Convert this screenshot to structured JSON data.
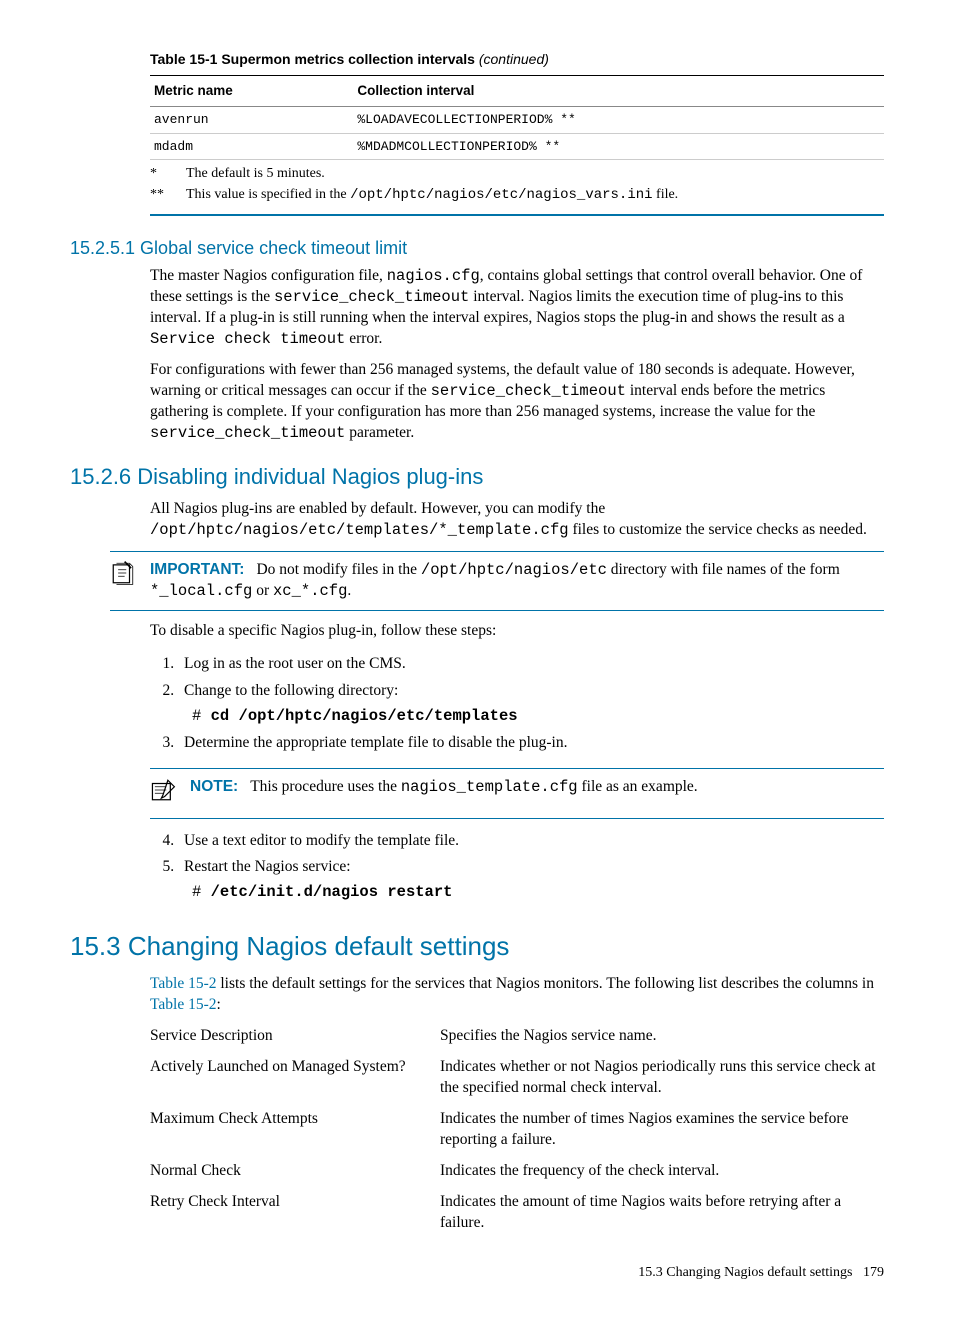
{
  "table": {
    "caption": "Table 15-1 Supermon metrics collection intervals",
    "continued": "(continued)",
    "headers": {
      "c1": "Metric name",
      "c2": "Collection interval"
    },
    "rows": [
      {
        "metric": "avenrun",
        "interval": "%LOADAVECOLLECTIONPERIOD% **"
      },
      {
        "metric": "mdadm",
        "interval": "%MDADMCOLLECTIONPERIOD% **"
      }
    ],
    "footnotes": [
      {
        "mark": "*",
        "text_a": "The default is 5 minutes."
      },
      {
        "mark": "**",
        "text_a": "This value is specified in the ",
        "code": "/opt/hptc/nagios/etc/nagios_vars.ini",
        "text_b": " file."
      }
    ]
  },
  "sec_15251": {
    "heading": "15.2.5.1 Global service check timeout limit",
    "p1_a": "The master Nagios configuration file, ",
    "p1_code1": "nagios.cfg",
    "p1_b": ", contains global settings that control overall behavior. One of these settings is the ",
    "p1_code2": "service_check_timeout",
    "p1_c": " interval. Nagios limits the execution time of plug-ins to this interval. If a plug-in is still running when the interval expires, Nagios stops the plug-in and shows the result as a ",
    "p1_code3": "Service check timeout",
    "p1_d": " error.",
    "p2_a": "For configurations with fewer than 256 managed systems, the default value of 180 seconds is adequate. However, warning or critical messages can occur if the ",
    "p2_code1": "service_check_timeout",
    "p2_b": " interval ends before the metrics gathering is complete. If your configuration has more than 256 managed systems, increase the value for the ",
    "p2_code2": "service_check_timeout",
    "p2_c": " parameter."
  },
  "sec_1526": {
    "heading": "15.2.6 Disabling individual Nagios plug-ins",
    "p1_a": "All Nagios plug-ins are enabled by default. However, you can modify the ",
    "p1_code1": "/opt/hptc/nagios/etc/templates/*_template.cfg",
    "p1_b": " files to customize the service checks as needed.",
    "important_label": "IMPORTANT:",
    "imp_a": "Do not modify files in the ",
    "imp_code1": "/opt/hptc/nagios/etc",
    "imp_b": " directory with file names of the form ",
    "imp_code2": "*_local.cfg",
    "imp_c": " or ",
    "imp_code3": "xc_*.cfg",
    "imp_d": ".",
    "p2": "To disable a specific Nagios plug-in, follow these steps:",
    "steps": {
      "s1": "Log in as the root user on the CMS.",
      "s2": "Change to the following directory:",
      "s2_prompt": "# ",
      "s2_cmd": "cd /opt/hptc/nagios/etc/templates",
      "s3": "Determine the appropriate template file to disable the plug-in.",
      "note_label": "NOTE:",
      "note_a": "This procedure uses the ",
      "note_code": "nagios_template.cfg",
      "note_b": " file as an example.",
      "s4": "Use a text editor to modify the template file.",
      "s5": "Restart the Nagios service:",
      "s5_prompt": "# ",
      "s5_cmd": "/etc/init.d/nagios restart"
    }
  },
  "sec_153": {
    "heading": "15.3 Changing Nagios default settings",
    "intro_a": "Table 15-2",
    "intro_b": " lists the default settings for the services that Nagios monitors. The following list describes the columns in ",
    "intro_c": "Table 15-2",
    "intro_d": ":",
    "defs": [
      {
        "term": "Service Description",
        "def": "Specifies the Nagios service name."
      },
      {
        "term": "Actively Launched on Managed System?",
        "def": "Indicates whether or not Nagios periodically runs this service check at the specified normal check interval."
      },
      {
        "term": "Maximum Check Attempts",
        "def": "Indicates the number of times Nagios examines the service before reporting a failure."
      },
      {
        "term": "Normal Check",
        "def": "Indicates the frequency of the check interval."
      },
      {
        "term": "Retry Check Interval",
        "def": "Indicates the amount of time Nagios waits before retrying after a failure."
      }
    ]
  },
  "footer": {
    "section": "15.3 Changing Nagios default settings",
    "page": "179"
  }
}
